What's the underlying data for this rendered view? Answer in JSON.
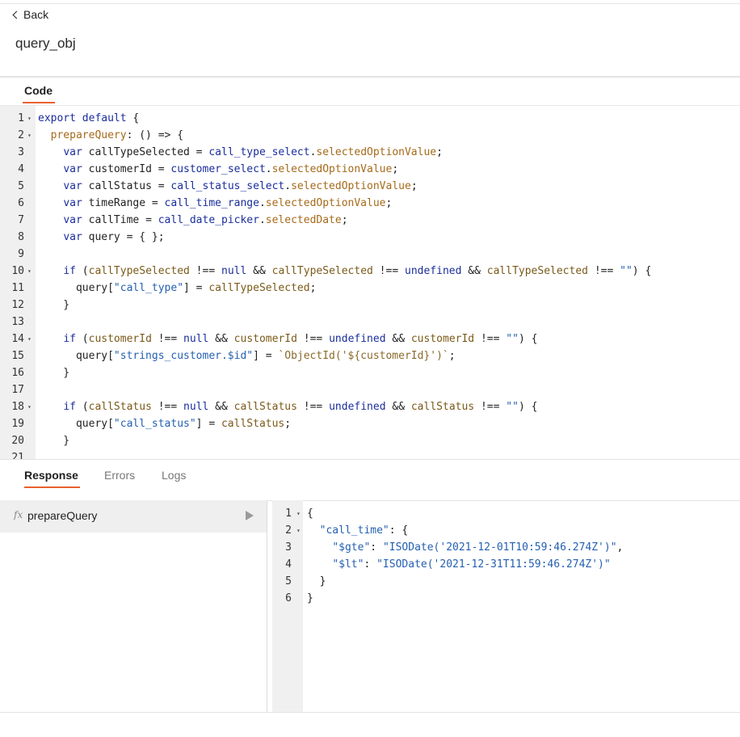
{
  "header": {
    "back_label": "Back",
    "title": "query_obj"
  },
  "editor_tabs": [
    {
      "label": "Code"
    }
  ],
  "code_lines": [
    {
      "n": "1",
      "fold": true,
      "t": [
        [
          "kw",
          "export default"
        ],
        [
          "p",
          " {"
        ]
      ]
    },
    {
      "n": "2",
      "fold": true,
      "t": [
        [
          "p",
          "  "
        ],
        [
          "prop",
          "prepareQuery"
        ],
        [
          "p",
          ": () => {"
        ]
      ]
    },
    {
      "n": "3",
      "fold": false,
      "t": [
        [
          "p",
          "    "
        ],
        [
          "kw",
          "var"
        ],
        [
          "p",
          " callTypeSelected = "
        ],
        [
          "kw",
          "call_type_select"
        ],
        [
          "p",
          "."
        ],
        [
          "prop",
          "selectedOptionValue"
        ],
        [
          "p",
          ";"
        ]
      ]
    },
    {
      "n": "4",
      "fold": false,
      "t": [
        [
          "p",
          "    "
        ],
        [
          "kw",
          "var"
        ],
        [
          "p",
          " customerId = "
        ],
        [
          "kw",
          "customer_select"
        ],
        [
          "p",
          "."
        ],
        [
          "prop",
          "selectedOptionValue"
        ],
        [
          "p",
          ";"
        ]
      ]
    },
    {
      "n": "5",
      "fold": false,
      "t": [
        [
          "p",
          "    "
        ],
        [
          "kw",
          "var"
        ],
        [
          "p",
          " callStatus = "
        ],
        [
          "kw",
          "call_status_select"
        ],
        [
          "p",
          "."
        ],
        [
          "prop",
          "selectedOptionValue"
        ],
        [
          "p",
          ";"
        ]
      ]
    },
    {
      "n": "6",
      "fold": false,
      "t": [
        [
          "p",
          "    "
        ],
        [
          "kw",
          "var"
        ],
        [
          "p",
          " timeRange = "
        ],
        [
          "kw",
          "call_time_range"
        ],
        [
          "p",
          "."
        ],
        [
          "prop",
          "selectedOptionValue"
        ],
        [
          "p",
          ";"
        ]
      ]
    },
    {
      "n": "7",
      "fold": false,
      "t": [
        [
          "p",
          "    "
        ],
        [
          "kw",
          "var"
        ],
        [
          "p",
          " callTime = "
        ],
        [
          "kw",
          "call_date_picker"
        ],
        [
          "p",
          "."
        ],
        [
          "prop",
          "selectedDate"
        ],
        [
          "p",
          ";"
        ]
      ]
    },
    {
      "n": "8",
      "fold": false,
      "t": [
        [
          "p",
          "    "
        ],
        [
          "kw",
          "var"
        ],
        [
          "p",
          " query = { };"
        ]
      ]
    },
    {
      "n": "9",
      "fold": false,
      "t": [
        [
          "p",
          ""
        ]
      ]
    },
    {
      "n": "10",
      "fold": true,
      "t": [
        [
          "p",
          "    "
        ],
        [
          "kw",
          "if"
        ],
        [
          "p",
          " ("
        ],
        [
          "var",
          "callTypeSelected"
        ],
        [
          "p",
          " !== "
        ],
        [
          "kw",
          "null"
        ],
        [
          "p",
          " && "
        ],
        [
          "var",
          "callTypeSelected"
        ],
        [
          "p",
          " !== "
        ],
        [
          "kw",
          "undefined"
        ],
        [
          "p",
          " && "
        ],
        [
          "var",
          "callTypeSelected"
        ],
        [
          "p",
          " !== "
        ],
        [
          "str",
          "\"\""
        ],
        [
          "p",
          ") {"
        ]
      ]
    },
    {
      "n": "11",
      "fold": false,
      "t": [
        [
          "p",
          "      query["
        ],
        [
          "str",
          "\"call_type\""
        ],
        [
          "p",
          "] = "
        ],
        [
          "var",
          "callTypeSelected"
        ],
        [
          "p",
          ";"
        ]
      ]
    },
    {
      "n": "12",
      "fold": false,
      "t": [
        [
          "p",
          "    }"
        ]
      ]
    },
    {
      "n": "13",
      "fold": false,
      "t": [
        [
          "p",
          ""
        ]
      ]
    },
    {
      "n": "14",
      "fold": true,
      "t": [
        [
          "p",
          "    "
        ],
        [
          "kw",
          "if"
        ],
        [
          "p",
          " ("
        ],
        [
          "var",
          "customerId"
        ],
        [
          "p",
          " !== "
        ],
        [
          "kw",
          "null"
        ],
        [
          "p",
          " && "
        ],
        [
          "var",
          "customerId"
        ],
        [
          "p",
          " !== "
        ],
        [
          "kw",
          "undefined"
        ],
        [
          "p",
          " && "
        ],
        [
          "var",
          "customerId"
        ],
        [
          "p",
          " !== "
        ],
        [
          "str",
          "\"\""
        ],
        [
          "p",
          ") {"
        ]
      ]
    },
    {
      "n": "15",
      "fold": false,
      "t": [
        [
          "p",
          "      query["
        ],
        [
          "str",
          "\"strings_customer.$id\""
        ],
        [
          "p",
          "] = "
        ],
        [
          "blt",
          "`ObjectId('${customerId}')`"
        ],
        [
          "p",
          ";"
        ]
      ]
    },
    {
      "n": "16",
      "fold": false,
      "t": [
        [
          "p",
          "    }"
        ]
      ]
    },
    {
      "n": "17",
      "fold": false,
      "t": [
        [
          "p",
          ""
        ]
      ]
    },
    {
      "n": "18",
      "fold": true,
      "t": [
        [
          "p",
          "    "
        ],
        [
          "kw",
          "if"
        ],
        [
          "p",
          " ("
        ],
        [
          "var",
          "callStatus"
        ],
        [
          "p",
          " !== "
        ],
        [
          "kw",
          "null"
        ],
        [
          "p",
          " && "
        ],
        [
          "var",
          "callStatus"
        ],
        [
          "p",
          " !== "
        ],
        [
          "kw",
          "undefined"
        ],
        [
          "p",
          " && "
        ],
        [
          "var",
          "callStatus"
        ],
        [
          "p",
          " !== "
        ],
        [
          "str",
          "\"\""
        ],
        [
          "p",
          ") {"
        ]
      ]
    },
    {
      "n": "19",
      "fold": false,
      "t": [
        [
          "p",
          "      query["
        ],
        [
          "str",
          "\"call_status\""
        ],
        [
          "p",
          "] = "
        ],
        [
          "var",
          "callStatus"
        ],
        [
          "p",
          ";"
        ]
      ]
    },
    {
      "n": "20",
      "fold": false,
      "t": [
        [
          "p",
          "    }"
        ]
      ]
    },
    {
      "n": "21",
      "fold": false,
      "t": [
        [
          "p",
          ""
        ]
      ]
    }
  ],
  "response_tabs": [
    {
      "label": "Response",
      "active": true
    },
    {
      "label": "Errors",
      "active": false
    },
    {
      "label": "Logs",
      "active": false
    }
  ],
  "functions": [
    {
      "fx_label": "fx",
      "name": "prepareQuery"
    }
  ],
  "response_lines": [
    {
      "n": "1",
      "fold": true,
      "t": [
        [
          "p",
          "{"
        ]
      ]
    },
    {
      "n": "2",
      "fold": true,
      "t": [
        [
          "p",
          "  "
        ],
        [
          "str",
          "\"call_time\""
        ],
        [
          "p",
          ": {"
        ]
      ]
    },
    {
      "n": "3",
      "fold": false,
      "t": [
        [
          "p",
          "    "
        ],
        [
          "str",
          "\"$gte\""
        ],
        [
          "p",
          ": "
        ],
        [
          "str",
          "\"ISODate('2021-12-01T10:59:46.274Z')\""
        ],
        [
          "p",
          ","
        ]
      ]
    },
    {
      "n": "4",
      "fold": false,
      "t": [
        [
          "p",
          "    "
        ],
        [
          "str",
          "\"$lt\""
        ],
        [
          "p",
          ": "
        ],
        [
          "str",
          "\"ISODate('2021-12-31T11:59:46.274Z')\""
        ]
      ]
    },
    {
      "n": "5",
      "fold": false,
      "t": [
        [
          "p",
          "  }"
        ]
      ]
    },
    {
      "n": "6",
      "fold": false,
      "t": [
        [
          "p",
          "}"
        ]
      ]
    }
  ],
  "fold_glyph": "▾"
}
